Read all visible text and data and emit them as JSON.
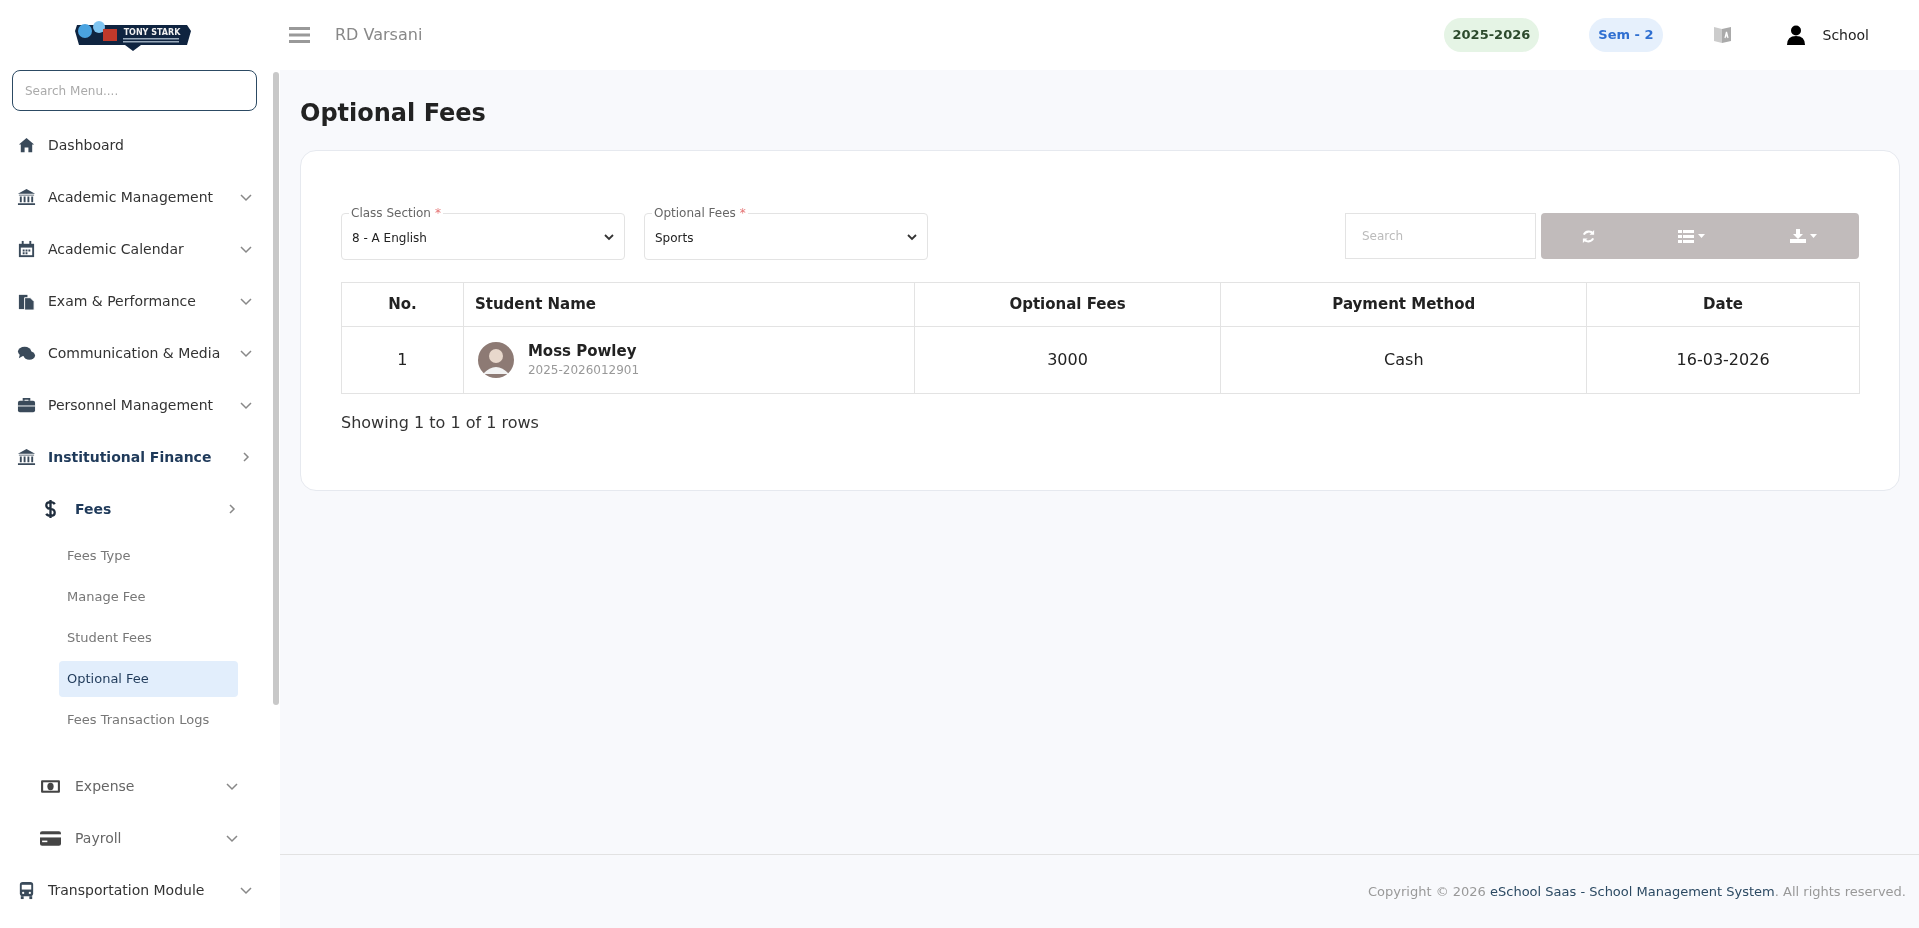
{
  "header": {
    "logo_text": "TONY STARK",
    "user_name": "RD Varsani",
    "session": "2025-2026",
    "semester": "Sem - 2",
    "account": "School"
  },
  "sidebar": {
    "search": {
      "placeholder": "Search Menu...."
    },
    "items": [
      {
        "label": "Dashboard",
        "active": false
      },
      {
        "label": "Academic Management",
        "expandable": true,
        "expanded": false,
        "active": false
      },
      {
        "label": "Academic Calendar",
        "expandable": true,
        "expanded": false,
        "active": false
      },
      {
        "label": "Exam & Performance",
        "expandable": true,
        "expanded": false,
        "active": false
      },
      {
        "label": "Communication & Media",
        "expandable": true,
        "expanded": false,
        "active": false
      },
      {
        "label": "Personnel Management",
        "expandable": true,
        "expanded": false,
        "active": false
      },
      {
        "label": "Institutional Finance",
        "expandable": true,
        "expanded": true,
        "active": true,
        "children": [
          {
            "label": "Fees",
            "expandable": true,
            "expanded": true,
            "active": true,
            "children": [
              {
                "label": "Fees Type",
                "selected": false
              },
              {
                "label": "Manage Fee",
                "selected": false
              },
              {
                "label": "Student Fees",
                "selected": false
              },
              {
                "label": "Optional Fee",
                "selected": true
              },
              {
                "label": "Fees Transaction Logs",
                "selected": false
              }
            ]
          },
          {
            "label": "Expense",
            "expandable": true,
            "expanded": false,
            "active": false
          },
          {
            "label": "Payroll",
            "expandable": true,
            "expanded": false,
            "active": false
          }
        ]
      },
      {
        "label": "Transportation Module",
        "expandable": true,
        "expanded": false,
        "active": false
      }
    ]
  },
  "page": {
    "title": "Optional Fees",
    "filters": [
      {
        "label": "Class Section",
        "required_mark": "*",
        "value": "8 - A English"
      },
      {
        "label": "Optional Fees",
        "required_mark": "*",
        "value": "Sports"
      }
    ],
    "search": {
      "placeholder": "Search"
    },
    "table": {
      "columns": [
        "No.",
        "Student Name",
        "Optional Fees",
        "Payment Method",
        "Date"
      ],
      "rows": [
        {
          "no": "1",
          "name": "Moss Powley",
          "admission": "2025-2026012901",
          "fees": "3000",
          "method": "Cash",
          "date": "16-03-2026"
        }
      ]
    },
    "summary": "Showing 1 to 1 of 1 rows"
  },
  "footer": {
    "copyright": "Copyright © 2026 ",
    "link": "eSchool Saas - School Management System",
    "suffix": ". All rights reserved."
  }
}
